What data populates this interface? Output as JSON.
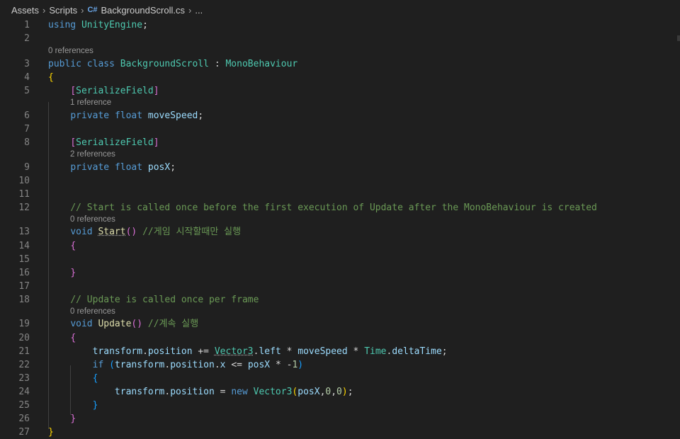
{
  "breadcrumb": {
    "items": [
      "Assets",
      "Scripts",
      "BackgroundScroll.cs",
      "..."
    ],
    "file_icon": "C#"
  },
  "lenses": {
    "l3": "0 references",
    "l6": "1 reference",
    "l9": "2 references",
    "l13": "0 references",
    "l19": "0 references"
  },
  "lines": [
    {
      "n": "1",
      "segs": [
        [
          "using",
          "kw"
        ],
        [
          " ",
          "pl"
        ],
        [
          "UnityEngine",
          "ty"
        ],
        [
          ";",
          "pl"
        ]
      ]
    },
    {
      "n": "2",
      "segs": []
    },
    {
      "n": "3",
      "segs": [
        [
          "public",
          "kw"
        ],
        [
          " ",
          "pl"
        ],
        [
          "class",
          "kw"
        ],
        [
          " ",
          "pl"
        ],
        [
          "BackgroundScroll",
          "ty"
        ],
        [
          " : ",
          "pl"
        ],
        [
          "MonoBehaviour",
          "ty"
        ]
      ]
    },
    {
      "n": "4",
      "segs": [
        [
          "{",
          "p1"
        ]
      ]
    },
    {
      "n": "5",
      "segs": [
        [
          "    ",
          "pl"
        ],
        [
          "[",
          "p2"
        ],
        [
          "SerializeField",
          "ty"
        ],
        [
          "]",
          "p2"
        ]
      ]
    },
    {
      "n": "6",
      "segs": [
        [
          "    ",
          "pl"
        ],
        [
          "private",
          "kw"
        ],
        [
          " ",
          "pl"
        ],
        [
          "float",
          "kw"
        ],
        [
          " ",
          "pl"
        ],
        [
          "moveSpeed",
          "vr"
        ],
        [
          ";",
          "pl"
        ]
      ]
    },
    {
      "n": "7",
      "segs": []
    },
    {
      "n": "8",
      "segs": [
        [
          "    ",
          "pl"
        ],
        [
          "[",
          "p2"
        ],
        [
          "SerializeField",
          "ty"
        ],
        [
          "]",
          "p2"
        ]
      ]
    },
    {
      "n": "9",
      "segs": [
        [
          "    ",
          "pl"
        ],
        [
          "private",
          "kw"
        ],
        [
          " ",
          "pl"
        ],
        [
          "float",
          "kw"
        ],
        [
          " ",
          "pl"
        ],
        [
          "posX",
          "vr"
        ],
        [
          ";",
          "pl"
        ]
      ]
    },
    {
      "n": "10",
      "segs": []
    },
    {
      "n": "11",
      "segs": []
    },
    {
      "n": "12",
      "segs": [
        [
          "    ",
          "pl"
        ],
        [
          "// Start is called once before the first execution of Update after the MonoBehaviour is created",
          "cm"
        ]
      ]
    },
    {
      "n": "13",
      "segs": [
        [
          "    ",
          "pl"
        ],
        [
          "void",
          "kw"
        ],
        [
          " ",
          "pl"
        ],
        [
          "Start",
          "fn wavy"
        ],
        [
          "()",
          "p2"
        ],
        [
          " ",
          "pl"
        ],
        [
          "//게임 시작할때만 실행",
          "cm"
        ]
      ]
    },
    {
      "n": "14",
      "segs": [
        [
          "    ",
          "pl"
        ],
        [
          "{",
          "p2"
        ]
      ]
    },
    {
      "n": "15",
      "segs": []
    },
    {
      "n": "16",
      "segs": [
        [
          "    ",
          "pl"
        ],
        [
          "}",
          "p2"
        ]
      ]
    },
    {
      "n": "17",
      "segs": []
    },
    {
      "n": "18",
      "segs": [
        [
          "    ",
          "pl"
        ],
        [
          "// Update is called once per frame",
          "cm"
        ]
      ]
    },
    {
      "n": "19",
      "segs": [
        [
          "    ",
          "pl"
        ],
        [
          "void",
          "kw"
        ],
        [
          " ",
          "pl"
        ],
        [
          "Update",
          "fn"
        ],
        [
          "()",
          "p2"
        ],
        [
          " ",
          "pl"
        ],
        [
          "//계속 실행",
          "cm"
        ]
      ]
    },
    {
      "n": "20",
      "segs": [
        [
          "    ",
          "pl"
        ],
        [
          "{",
          "p2"
        ]
      ]
    },
    {
      "n": "21",
      "segs": [
        [
          "        ",
          "pl"
        ],
        [
          "transform",
          "vr"
        ],
        [
          ".",
          "pl"
        ],
        [
          "position",
          "vr"
        ],
        [
          " += ",
          "pl"
        ],
        [
          "Vector3",
          "ty wavy"
        ],
        [
          ".",
          "pl"
        ],
        [
          "left",
          "vr"
        ],
        [
          " * ",
          "pl"
        ],
        [
          "moveSpeed",
          "vr"
        ],
        [
          " * ",
          "pl"
        ],
        [
          "Time",
          "ty"
        ],
        [
          ".",
          "pl"
        ],
        [
          "deltaTime",
          "vr"
        ],
        [
          ";",
          "pl"
        ]
      ]
    },
    {
      "n": "22",
      "segs": [
        [
          "        ",
          "pl"
        ],
        [
          "if",
          "kw"
        ],
        [
          " ",
          "pl"
        ],
        [
          "(",
          "p3"
        ],
        [
          "transform",
          "vr"
        ],
        [
          ".",
          "pl"
        ],
        [
          "position",
          "vr"
        ],
        [
          ".",
          "pl"
        ],
        [
          "x",
          "vr"
        ],
        [
          " <= ",
          "pl"
        ],
        [
          "posX",
          "vr"
        ],
        [
          " * -",
          "pl"
        ],
        [
          "1",
          "nm"
        ],
        [
          ")",
          "p3"
        ]
      ]
    },
    {
      "n": "23",
      "segs": [
        [
          "        ",
          "pl"
        ],
        [
          "{",
          "p3"
        ]
      ]
    },
    {
      "n": "24",
      "segs": [
        [
          "            ",
          "pl"
        ],
        [
          "transform",
          "vr"
        ],
        [
          ".",
          "pl"
        ],
        [
          "position",
          "vr"
        ],
        [
          " = ",
          "pl"
        ],
        [
          "new",
          "kw"
        ],
        [
          " ",
          "pl"
        ],
        [
          "Vector3",
          "ty"
        ],
        [
          "(",
          "p1"
        ],
        [
          "posX",
          "vr"
        ],
        [
          ",",
          "pl"
        ],
        [
          "0",
          "nm"
        ],
        [
          ",",
          "pl"
        ],
        [
          "0",
          "nm"
        ],
        [
          ")",
          "p1"
        ],
        [
          ";",
          "pl"
        ]
      ]
    },
    {
      "n": "25",
      "segs": [
        [
          "        ",
          "pl"
        ],
        [
          "}",
          "p3"
        ]
      ]
    },
    {
      "n": "26",
      "segs": [
        [
          "    ",
          "pl"
        ],
        [
          "}",
          "p2"
        ]
      ]
    },
    {
      "n": "27",
      "segs": [
        [
          "}",
          "p1"
        ]
      ]
    }
  ]
}
